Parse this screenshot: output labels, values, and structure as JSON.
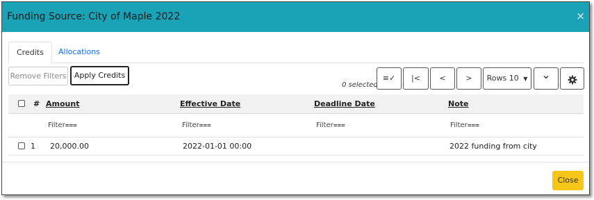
{
  "modal": {
    "title": "Funding Source: City of Maple 2022",
    "close_icon": "×"
  },
  "tabs": [
    {
      "label": "Credits",
      "active": true
    },
    {
      "label": "Allocations",
      "active": false
    }
  ],
  "toolbar": {
    "remove_filters": "Remove Filters",
    "apply_credits": "Apply Credits",
    "selected_count": "0 selected",
    "column_picker_icon": "≡✓",
    "first_page_icon": "|<",
    "prev_page_icon": "<",
    "next_page_icon": ">",
    "rows_label": "Rows 10",
    "expand_icon": "chevron-down",
    "settings_icon": "gear"
  },
  "grid": {
    "columns": [
      "#",
      "Amount",
      "Effective Date",
      "Deadline Date",
      "Note"
    ],
    "filter_label": "Filter",
    "rows": [
      {
        "index": "1",
        "amount": "20,000.00",
        "effective_date": "2022-01-01 00:00",
        "deadline_date": "",
        "note": "2022 funding from city"
      }
    ]
  },
  "footer": {
    "close_label": "Close"
  },
  "colors": {
    "header_bg": "#1aa3b6",
    "close_button_bg": "#f5c518",
    "link": "#0d6efd"
  }
}
